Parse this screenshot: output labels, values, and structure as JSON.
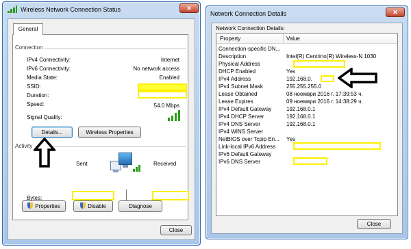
{
  "status_window": {
    "title": "Wireless Network Connection Status",
    "close_glyph": "✕",
    "tab": "General",
    "connection_header": "Connection",
    "rows": [
      {
        "label": "IPv4 Connectivity:",
        "value": "Internet"
      },
      {
        "label": "IPv6 Connectivity:",
        "value": "No network access"
      },
      {
        "label": "Media State:",
        "value": "Enabled"
      },
      {
        "label": "SSID:",
        "value": ""
      },
      {
        "label": "Duration:",
        "value": ""
      },
      {
        "label": "Speed:",
        "value": "54.0 Mbps"
      }
    ],
    "signal_label": "Signal Quality:",
    "details_button": "Details...",
    "wireless_props_button": "Wireless Properties",
    "activity_header": "Activity",
    "sent_label": "Sent",
    "received_label": "Received",
    "bytes_label": "Bytes:",
    "properties_button": "Properties",
    "disable_button": "Disable",
    "diagnose_button": "Diagnose",
    "close_button": "Close"
  },
  "details_window": {
    "title": "Network Connection Details",
    "subtitle": "Network Connection Details:",
    "col_property": "Property",
    "col_value": "Value",
    "rows": [
      {
        "property": "Connection-specific DN...",
        "value": ""
      },
      {
        "property": "Description",
        "value": "Intel(R) Centrino(R) Wireless-N 1030"
      },
      {
        "property": "Physical Address",
        "value": ""
      },
      {
        "property": "DHCP Enabled",
        "value": "Yes"
      },
      {
        "property": "IPv4 Address",
        "value": "192.168.0."
      },
      {
        "property": "IPv4 Subnet Mask",
        "value": "255.255.255.0"
      },
      {
        "property": "Lease Obtained",
        "value": "08 ноември 2016 г. 17:39:53 ч."
      },
      {
        "property": "Lease Expires",
        "value": "09 ноември 2016 г. 14:38:29 ч."
      },
      {
        "property": "IPv4 Default Gateway",
        "value": "192.168.0.1"
      },
      {
        "property": "IPv4 DHCP Server",
        "value": "192.168.0.1"
      },
      {
        "property": "IPv4 DNS Server",
        "value": "192.168.0.1"
      },
      {
        "property": "IPv4 WINS Server",
        "value": ""
      },
      {
        "property": "NetBIOS over Tcpip En...",
        "value": "Yes"
      },
      {
        "property": "Link-local IPv6 Address",
        "value": ""
      },
      {
        "property": "IPv6 Default Gateway",
        "value": ""
      },
      {
        "property": "IPv6 DNS Server",
        "value": ""
      }
    ],
    "close_button": "Close"
  },
  "annotations": {
    "highlight_color": "#ffef00",
    "arrow_color": "#000000"
  },
  "icons": {
    "title_icon": "signal-bars-icon",
    "network_icon": "computer-network-icon",
    "shield": "uac-shield-icon"
  }
}
